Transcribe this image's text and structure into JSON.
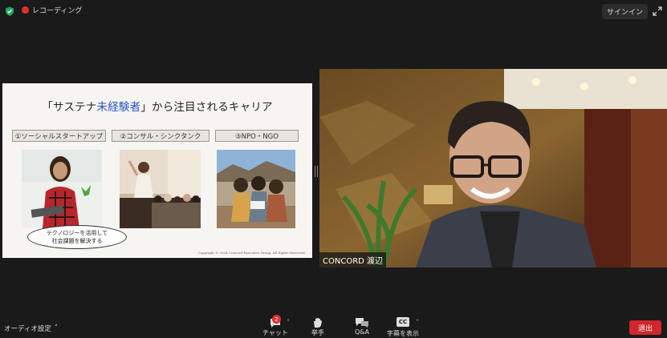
{
  "topbar": {
    "recording_label": "レコーディング",
    "signin_label": "サインイン"
  },
  "slide": {
    "title_pre": "「サステナ",
    "title_em": "未経験者",
    "title_post": "」から注目されるキャリア",
    "categories": [
      "①ソーシャルスタートアップ",
      "②コンサル・シンクタンク",
      "③NPO・NGO"
    ],
    "callout_line1": "テクノロジーを活用して",
    "callout_line2": "社会課題を解決する",
    "copyright": "Copyright © 2024 Concord Executive Group. All Rights Reserved."
  },
  "video": {
    "participant_name": "CONCORD 渡辺"
  },
  "toolbar": {
    "audio_label": "オーディオ設定",
    "chat_label": "チャット",
    "chat_badge": "2",
    "raise_hand_label": "挙手",
    "qa_label": "Q&A",
    "cc_icon_text": "CC",
    "captions_label": "字幕を表示",
    "leave_label": "退出"
  },
  "colors": {
    "accent_red": "#d0262c",
    "title_emphasis": "#2a52c9",
    "background": "#1a1a1a"
  }
}
